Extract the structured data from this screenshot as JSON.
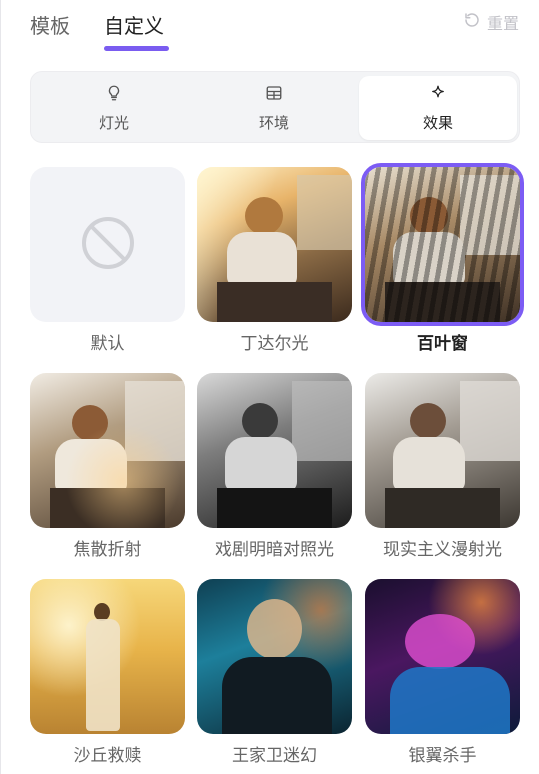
{
  "header": {
    "tabs": [
      {
        "label": "模板"
      },
      {
        "label": "自定义"
      }
    ],
    "reset_label": "重置",
    "accent": "#7a5cf0"
  },
  "segments": [
    {
      "label": "灯光",
      "icon": "bulb-icon"
    },
    {
      "label": "环境",
      "icon": "window-icon"
    },
    {
      "label": "效果",
      "icon": "sparkle-icon"
    }
  ],
  "effects": [
    {
      "label": "默认",
      "icon": "ban-icon"
    },
    {
      "label": "丁达尔光"
    },
    {
      "label": "百叶窗",
      "selected": true
    },
    {
      "label": "焦散折射"
    },
    {
      "label": "戏剧明暗对照光"
    },
    {
      "label": "现实主义漫射光"
    },
    {
      "label": "沙丘救赎"
    },
    {
      "label": "王家卫迷幻"
    },
    {
      "label": "银翼杀手"
    }
  ]
}
